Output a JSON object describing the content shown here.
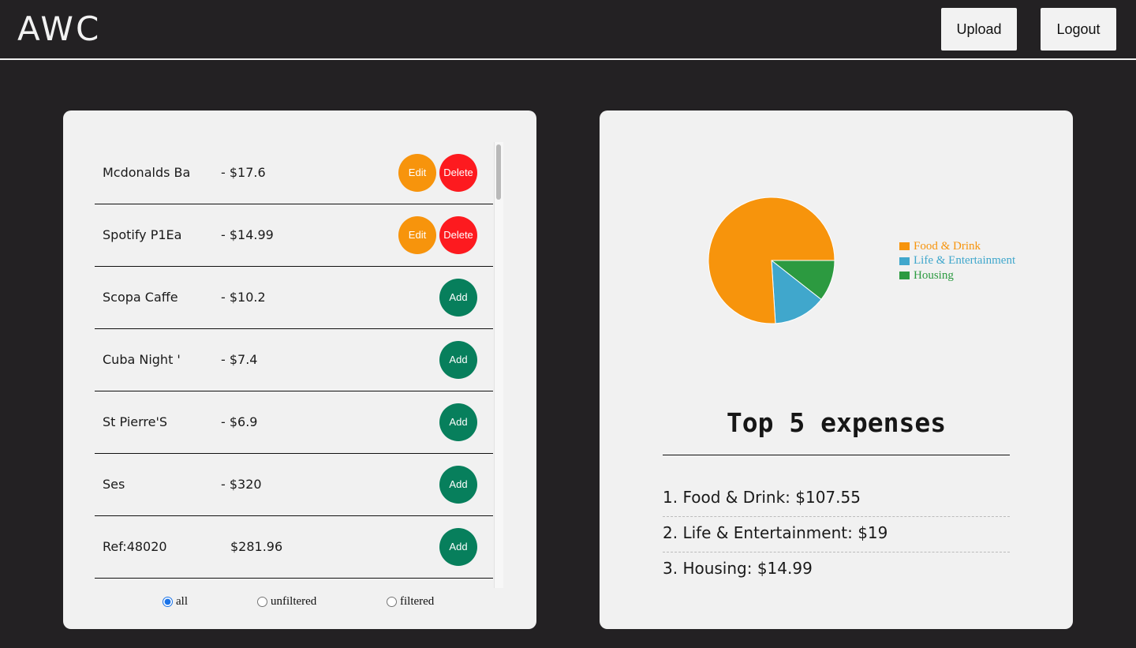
{
  "header": {
    "logo": "AWC",
    "upload_label": "Upload",
    "logout_label": "Logout"
  },
  "transactions": [
    {
      "name": "Mcdonalds Ba",
      "amount": "- $17.6",
      "actions": [
        "Edit",
        "Delete"
      ]
    },
    {
      "name": "Spotify P1Ea",
      "amount": "- $14.99",
      "actions": [
        "Edit",
        "Delete"
      ]
    },
    {
      "name": "Scopa Caffe",
      "amount": "- $10.2",
      "actions": [
        "Add"
      ]
    },
    {
      "name": "Cuba Night '",
      "amount": "- $7.4",
      "actions": [
        "Add"
      ]
    },
    {
      "name": "St Pierre'S",
      "amount": "- $6.9",
      "actions": [
        "Add"
      ]
    },
    {
      "name": "Ses",
      "amount": "- $320",
      "actions": [
        "Add"
      ]
    },
    {
      "name": "Ref:48020",
      "amount": "$281.96",
      "actions": [
        "Add"
      ]
    }
  ],
  "filters": {
    "options": [
      "all",
      "unfiltered",
      "filtered"
    ],
    "selected": "all"
  },
  "colors": {
    "edit": "#f7940c",
    "delete": "#fd1a1f",
    "add": "#077f5c",
    "background": "#232123",
    "card": "#f1f1f1"
  },
  "chart_data": {
    "type": "pie",
    "categories": [
      "Food & Drink",
      "Life & Entertainment",
      "Housing"
    ],
    "values": [
      107.55,
      19,
      14.99
    ],
    "colors": [
      "#f7940c",
      "#40a7cc",
      "#2c9a40"
    ],
    "legend": "right"
  },
  "summary": {
    "title": "Top 5 expenses",
    "items": [
      "1. Food & Drink: $107.55",
      "2. Life & Entertainment: $19",
      "3. Housing: $14.99"
    ]
  }
}
